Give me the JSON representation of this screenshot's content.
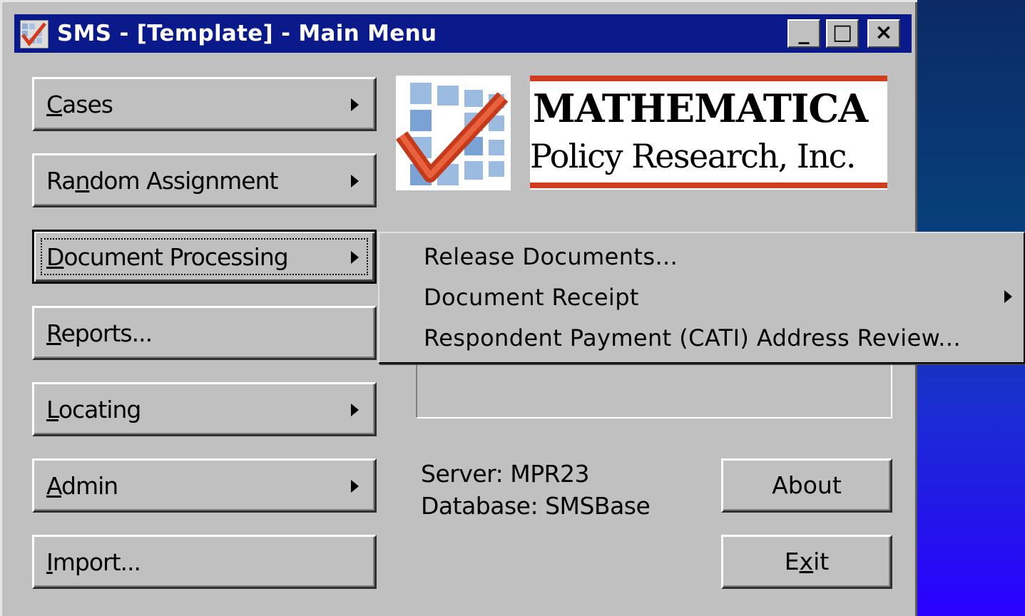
{
  "window": {
    "title": "SMS - [Template] - Main Menu",
    "controls": {
      "minimize": "_",
      "maximize": "□",
      "close": "×"
    }
  },
  "menu_buttons": [
    {
      "label_pre": "",
      "label_u": "C",
      "label_post": "ases",
      "has_submenu": true
    },
    {
      "label_pre": "Ra",
      "label_u": "n",
      "label_post": "dom Assignment",
      "has_submenu": true
    },
    {
      "label_pre": "",
      "label_u": "D",
      "label_post": "ocument Processing",
      "has_submenu": true,
      "focused": true
    },
    {
      "label_pre": "",
      "label_u": "R",
      "label_post": "eports...",
      "has_submenu": false
    },
    {
      "label_pre": "",
      "label_u": "L",
      "label_post": "ocating",
      "has_submenu": true
    },
    {
      "label_pre": "",
      "label_u": "A",
      "label_post": "dmin",
      "has_submenu": true
    },
    {
      "label_pre": "",
      "label_u": "I",
      "label_post": "mport...",
      "has_submenu": false
    }
  ],
  "logo": {
    "company": "MATHEMATICA",
    "tagline": "Policy Research, Inc.",
    "accent": "#d23c1e"
  },
  "submenu": {
    "items": [
      {
        "label": "Release Documents..."
      },
      {
        "label": "Document Receipt",
        "has_submenu": true
      },
      {
        "label": "Respondent Payment (CATI) Address Review..."
      }
    ]
  },
  "info": {
    "server": "Server: MPR23",
    "database": "Database: SMSBase"
  },
  "side_buttons": {
    "about": "About",
    "exit_pre": "E",
    "exit_u": "x",
    "exit_post": "it"
  },
  "colors": {
    "titlebar": "#0a1a8a",
    "face": "#c0c0c0",
    "desktop_top": "#073f78",
    "desktop_bottom": "#2a00ff"
  }
}
